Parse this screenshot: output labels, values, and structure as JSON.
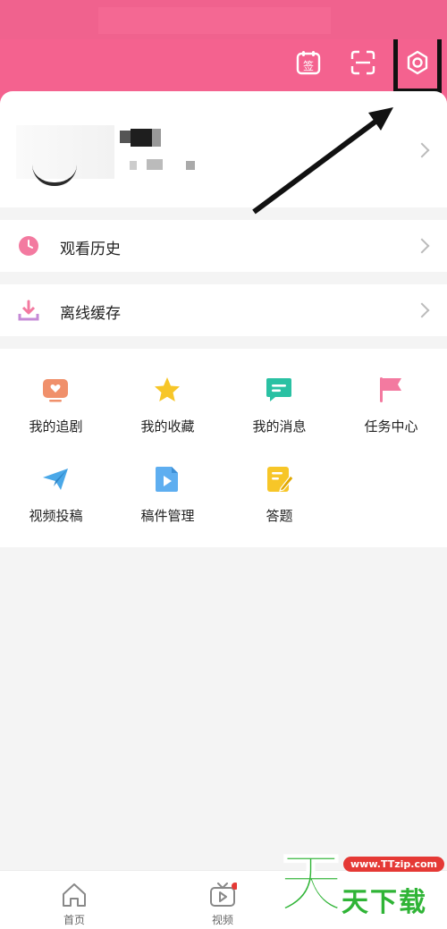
{
  "header": {
    "checkin_icon_text": "签",
    "icons": [
      "calendar-checkin-icon",
      "scan-icon",
      "settings-icon"
    ]
  },
  "rows": {
    "history_label": "观看历史",
    "offline_label": "离线缓存"
  },
  "grid": [
    {
      "label": "我的追剧",
      "icon": "tv-heart-icon",
      "color": "#f0906b"
    },
    {
      "label": "我的收藏",
      "icon": "star-icon",
      "color": "#f7c628"
    },
    {
      "label": "我的消息",
      "icon": "message-icon",
      "color": "#2ac1a3"
    },
    {
      "label": "任务中心",
      "icon": "flag-icon",
      "color": "#f37aa0"
    },
    {
      "label": "视频投稿",
      "icon": "paper-plane-icon",
      "color": "#4aa8e8"
    },
    {
      "label": "稿件管理",
      "icon": "video-file-icon",
      "color": "#5eaef0"
    },
    {
      "label": "答题",
      "icon": "quiz-note-icon",
      "color": "#f7c628"
    }
  ],
  "tabbar": {
    "home_label": "首页",
    "video_label": "视频"
  },
  "watermark": {
    "big": "天",
    "url": "www.TTzip.com",
    "sub": "天下载"
  },
  "colors": {
    "brand": "#f4628f",
    "background": "#f4f4f4"
  }
}
